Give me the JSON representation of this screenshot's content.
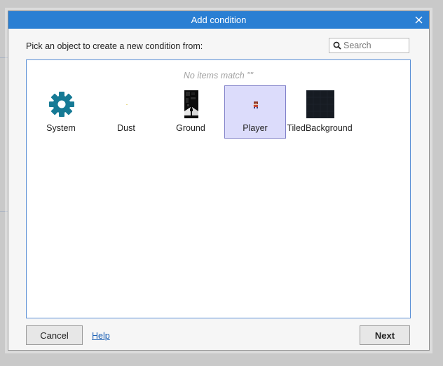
{
  "dialog": {
    "title": "Add condition",
    "prompt": "Pick an object to create a new condition from:",
    "search": {
      "placeholder": "Search",
      "value": ""
    },
    "no_items_text": "No items match \"\"",
    "objects": [
      {
        "label": "System",
        "icon": "gear-icon",
        "selected": false
      },
      {
        "label": "Dust",
        "icon": "dust-sprite",
        "selected": false
      },
      {
        "label": "Ground",
        "icon": "ground-tileset",
        "selected": false
      },
      {
        "label": "Player",
        "icon": "player-sprite",
        "selected": true
      },
      {
        "label": "TiledBackground",
        "icon": "tiled-background-thumbnail",
        "selected": false
      }
    ],
    "buttons": {
      "cancel": "Cancel",
      "help": "Help",
      "next": "Next"
    }
  },
  "colors": {
    "titlebar": "#2a7fd3",
    "selection": "#dcdcfb",
    "gear": "#167a95",
    "link": "#1a5fb4"
  }
}
